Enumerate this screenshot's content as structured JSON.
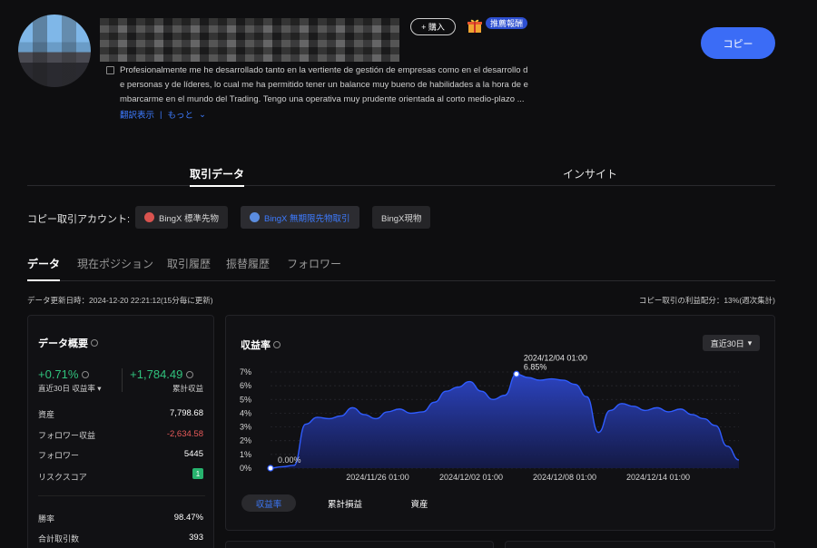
{
  "header": {
    "buy_label": "+ 購入",
    "recommend_badge": "推薦報酬",
    "copy_button": "コピー",
    "bio": "Profesionalmente me he desarrollado tanto en la vertiente de gestión de empresas como en el desarrollo de personas y de líderes, lo cual me ha permitido tener un balance muy bueno de habilidades a la hora de embarcarme en el mundo del Trading. Tengo una operativa muy prudente orientada al corto medio-plazo ...",
    "bio_lines": [
      "Profesionalmente me he desarrollado tanto en la vertiente de gestión de empresas como en el desarrollo d",
      "e personas y de líderes, lo cual me ha permitido tener un balance muy bueno de habilidades a la hora de e",
      "mbarcarme en el mundo del Trading. Tengo una operativa muy prudente orientada al corto medio-plazo ..."
    ],
    "translate_link": "翻訳表示",
    "more_link": "もっと"
  },
  "main_tabs": [
    "取引データ",
    "インサイト"
  ],
  "accounts": {
    "label": "コピー取引アカウント:",
    "chips": [
      "BingX 標準先物",
      "BingX 無期限先物取引",
      "BingX現物"
    ]
  },
  "sub_tabs": [
    "データ",
    "現在ポジション",
    "取引履歴",
    "振替履歴",
    "フォロワー"
  ],
  "updated_text": "データ更新日時：2024-12-20 22:21:12(15分毎に更新)",
  "profit_share_text": "コピー取引の利益配分：13%(週次集計)",
  "overview": {
    "title": "データ概要",
    "pct": "+0.71%",
    "profit": "+1,784.49",
    "pct_label": "直近30日 収益率",
    "profit_label": "累計収益",
    "rows": [
      {
        "label": "資産",
        "value": "7,798.68"
      },
      {
        "label": "フォロワー収益",
        "value": "-2,634.58"
      },
      {
        "label": "フォロワー",
        "value": "5445"
      },
      {
        "label": "リスクスコア",
        "value": "1"
      }
    ],
    "rows2": [
      {
        "label": "勝率",
        "value": "98.47%"
      },
      {
        "label": "合計取引数",
        "value": "393"
      }
    ]
  },
  "chart": {
    "title": "収益率",
    "range": "直近30日",
    "tabs": [
      "収益率",
      "累計損益",
      "資産"
    ],
    "tooltip_date": "2024/12/04 01:00",
    "tooltip_value": "6.85%",
    "start_label": "0.00%"
  },
  "chart_data": {
    "type": "area",
    "title": "収益率",
    "y_ticks": [
      "7%",
      "6%",
      "5%",
      "4%",
      "3%",
      "2%",
      "1%",
      "0%"
    ],
    "x_ticks": [
      "2024/11/26 01:00",
      "2024/12/02 01:00",
      "2024/12/08 01:00",
      "2024/12/14 01:00"
    ],
    "ylim": [
      0,
      7
    ],
    "series": [
      {
        "values": [
          0.0,
          0.1,
          0.2,
          3.2,
          3.7,
          3.6,
          3.8,
          4.4,
          3.9,
          3.6,
          4.1,
          4.3,
          4.0,
          4.1,
          4.8,
          5.6,
          5.9,
          6.3,
          5.6,
          5.0,
          5.3,
          6.85,
          6.6,
          6.4,
          6.5,
          6.4,
          6.1,
          5.2,
          2.6,
          4.2,
          4.7,
          4.5,
          4.2,
          4.4,
          4.1,
          4.3,
          3.9,
          3.6,
          3.1,
          1.6,
          0.6
        ]
      }
    ],
    "color": "#2f5cff",
    "grid": true
  }
}
